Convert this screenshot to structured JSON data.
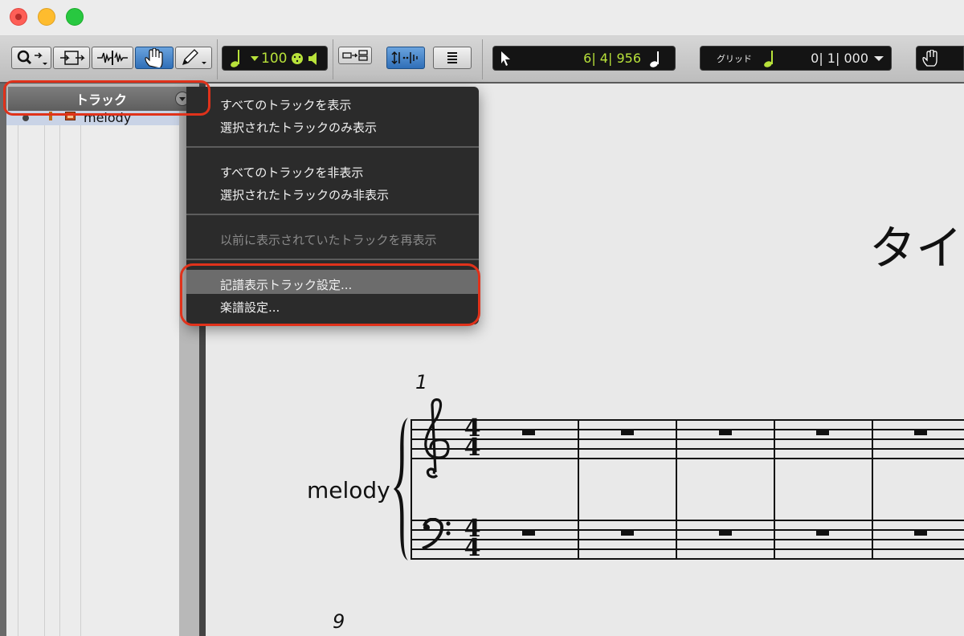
{
  "window": {
    "traffic_lights": [
      "close",
      "minimize",
      "zoom"
    ]
  },
  "toolbar": {
    "tools": [
      "zoom-tool-icon",
      "trim-tool-icon",
      "select-tool-icon",
      "grabber-tool-icon",
      "pencil-tool-icon"
    ],
    "tempo_value": "100",
    "counter_value": "6| 4| 956",
    "grid_label": "グリッド",
    "grid_value": "0| 1| 000"
  },
  "track_panel": {
    "header_label": "トラック",
    "tracks": [
      {
        "name": "melody"
      }
    ]
  },
  "context_menu": {
    "groups": [
      [
        "すべてのトラックを表示",
        "選択されたトラックのみ表示"
      ],
      [
        "すべてのトラックを非表示",
        "選択されたトラックのみ非表示"
      ],
      [
        "以前に表示されていたトラックを再表示"
      ],
      [
        "記譜表示トラック設定...",
        "楽譜設定..."
      ]
    ],
    "disabled_item": "以前に表示されていたトラックを再表示",
    "highlighted_item": "記譜表示トラック設定..."
  },
  "score": {
    "title": "タイ",
    "instrument_name": "melody",
    "measure_numbers": [
      "1",
      "9"
    ],
    "time_signature": {
      "numerator": "4",
      "denominator": "4"
    }
  },
  "colors": {
    "lcd_text": "#b8e23a",
    "highlight_outline": "#e0321b",
    "menu_bg": "#2b2b2b",
    "active_tool": "#2f6fb8"
  }
}
